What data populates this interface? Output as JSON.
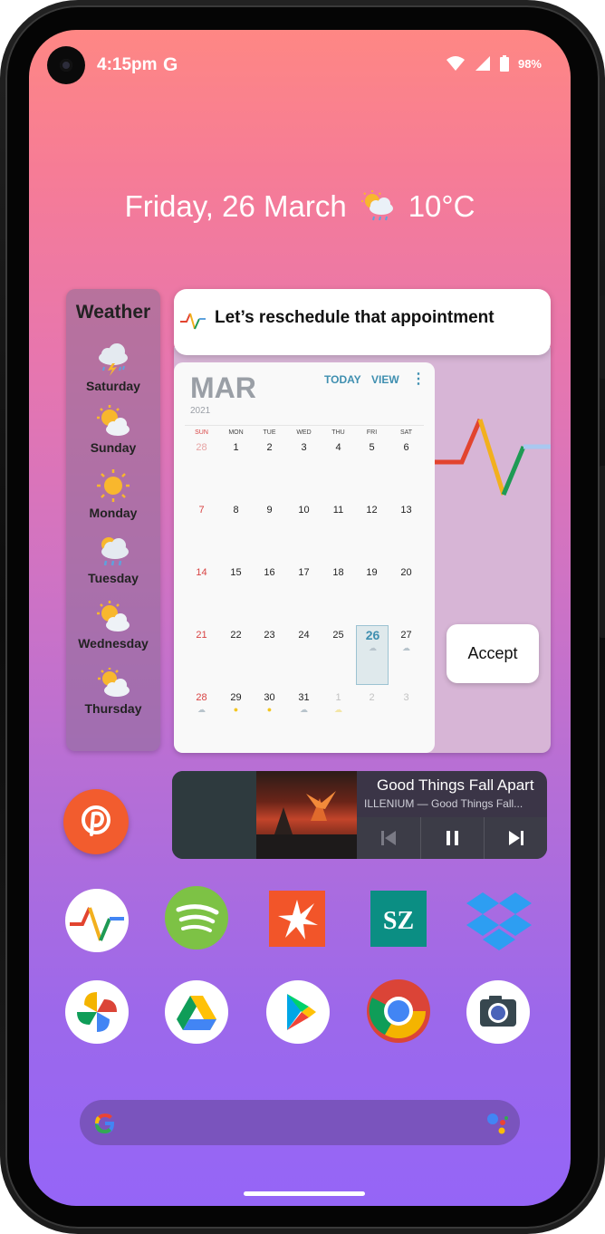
{
  "status_bar": {
    "time": "4:15pm",
    "google_icon": "G",
    "battery": "98%"
  },
  "at_a_glance": {
    "date": "Friday, 26 March",
    "temperature": "10°C",
    "weather_icon": "rain-cloud-sun-icon"
  },
  "weather_widget": {
    "title": "Weather",
    "days": [
      {
        "label": "Saturday",
        "icon": "thunderstorm-icon"
      },
      {
        "label": "Sunday",
        "icon": "partly-cloudy-icon"
      },
      {
        "label": "Monday",
        "icon": "sun-icon"
      },
      {
        "label": "Tuesday",
        "icon": "rain-icon"
      },
      {
        "label": "Wednesday",
        "icon": "partly-cloudy-icon"
      },
      {
        "label": "Thursday",
        "icon": "partly-cloudy-icon"
      }
    ]
  },
  "notification": {
    "text": "Let’s reschedule that appointment",
    "accept_label": "Accept"
  },
  "calendar": {
    "month": "MAR",
    "year": "2021",
    "today_label": "TODAY",
    "view_label": "VIEW",
    "more_label": "⋮",
    "weekdays": [
      "SUN",
      "MON",
      "TUE",
      "WED",
      "THU",
      "FRI",
      "SAT"
    ],
    "weeks": [
      [
        "28",
        "1",
        "2",
        "3",
        "4",
        "5",
        "6"
      ],
      [
        "7",
        "8",
        "9",
        "10",
        "11",
        "12",
        "13"
      ],
      [
        "14",
        "15",
        "16",
        "17",
        "18",
        "19",
        "20"
      ],
      [
        "21",
        "22",
        "23",
        "24",
        "25",
        "26",
        "27"
      ],
      [
        "28",
        "29",
        "30",
        "31",
        "1",
        "2",
        "3"
      ]
    ],
    "selected_day": "26"
  },
  "music": {
    "title": "Good Things Fall Apart",
    "artist_line": "ILLENIUM — Good Things Fall..."
  },
  "dock_row_1": [
    {
      "name": "pulse-app",
      "icon": "pulse-icon"
    },
    {
      "name": "spotify",
      "icon": "spotify-icon"
    },
    {
      "name": "news-app",
      "icon": "star-burst-icon"
    },
    {
      "name": "sz-app",
      "icon": "sz-icon",
      "label": "SZ"
    },
    {
      "name": "dropbox",
      "icon": "dropbox-icon"
    }
  ],
  "dock_row_2": [
    {
      "name": "google-photos",
      "icon": "pinwheel-icon"
    },
    {
      "name": "google-drive",
      "icon": "drive-icon"
    },
    {
      "name": "play-store",
      "icon": "play-icon"
    },
    {
      "name": "chrome",
      "icon": "chrome-icon"
    },
    {
      "name": "camera",
      "icon": "camera-icon"
    }
  ],
  "search_bar": {
    "google_icon": "G"
  },
  "colors": {
    "accent": "#3f8fb0",
    "weekend_red": "#d84343"
  }
}
